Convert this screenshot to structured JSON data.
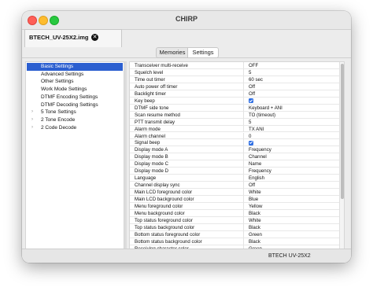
{
  "window": {
    "title": "CHIRP"
  },
  "file_tab": {
    "label": "BTECH_UV-25X2.img",
    "close_glyph": "✕"
  },
  "view_tabs": [
    {
      "label": "Memories"
    },
    {
      "label": "Settings"
    }
  ],
  "tree": [
    {
      "label": "Basic Settings",
      "selected": true,
      "expander": ""
    },
    {
      "label": "Advanced Settings",
      "expander": ""
    },
    {
      "label": "Other Settings",
      "expander": ""
    },
    {
      "label": "Work Mode Settings",
      "expander": ""
    },
    {
      "label": "DTMF Encoding Settings",
      "expander": ""
    },
    {
      "label": "DTMF Decoding Settings",
      "expander": ""
    },
    {
      "label": "5 Tone Settings",
      "expander": "›"
    },
    {
      "label": "2 Tone Encode",
      "expander": "›"
    },
    {
      "label": "2 Code Decode",
      "expander": "›"
    }
  ],
  "settings": [
    {
      "name": "Transceiver multi-receive",
      "value": "OFF"
    },
    {
      "name": "Squelch level",
      "value": "5"
    },
    {
      "name": "Time out timer",
      "value": "60 sec"
    },
    {
      "name": "Auto power off timer",
      "value": "Off"
    },
    {
      "name": "Backlight timer",
      "value": "Off"
    },
    {
      "name": "Key beep",
      "value": "",
      "checkbox": true
    },
    {
      "name": "DTMF side tone",
      "value": "Keyboard + ANI"
    },
    {
      "name": "Scan resume method",
      "value": "TO (timeout)"
    },
    {
      "name": "PTT transmit delay",
      "value": "5"
    },
    {
      "name": "Alarm mode",
      "value": "TX ANI"
    },
    {
      "name": "Alarm channel",
      "value": "0"
    },
    {
      "name": "Signal beep",
      "value": "",
      "checkbox": true
    },
    {
      "name": "Display mode A",
      "value": "Frequency"
    },
    {
      "name": "Display mode B",
      "value": "Channel"
    },
    {
      "name": "Display mode C",
      "value": "Name"
    },
    {
      "name": "Display mode D",
      "value": "Frequency"
    },
    {
      "name": "Language",
      "value": "English"
    },
    {
      "name": "Channel display sync",
      "value": "Off"
    },
    {
      "name": "Main LCD foreground color",
      "value": "White"
    },
    {
      "name": "Main LCD background color",
      "value": "Blue"
    },
    {
      "name": "Menu foreground color",
      "value": "Yellow"
    },
    {
      "name": "Menu background color",
      "value": "Black"
    },
    {
      "name": "Top status foreground color",
      "value": "White"
    },
    {
      "name": "Top status background color",
      "value": "Black"
    },
    {
      "name": "Bottom status foreground color",
      "value": "Green"
    },
    {
      "name": "Bottom status background color",
      "value": "Black"
    },
    {
      "name": "Receiving character color",
      "value": "Green"
    }
  ],
  "status": {
    "text": "BTECH UV-25X2"
  }
}
